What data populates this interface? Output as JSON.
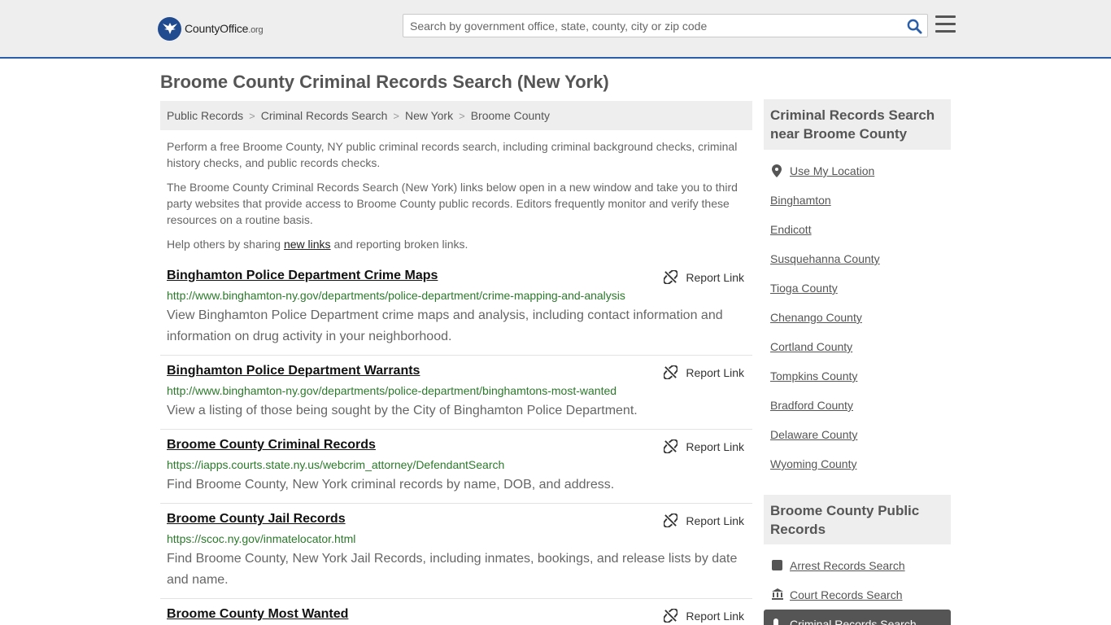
{
  "header": {
    "logo_main": "CountyOffice",
    "logo_tld": ".org",
    "search_placeholder": "Search by government office, state, county, city or zip code"
  },
  "page_title": "Broome County Criminal Records Search (New York)",
  "breadcrumb": [
    "Public Records",
    "Criminal Records Search",
    "New York",
    "Broome County"
  ],
  "intro": {
    "p1": "Perform a free Broome County, NY public criminal records search, including criminal background checks, criminal history checks, and public records checks.",
    "p2": "The Broome County Criminal Records Search (New York) links below open in a new window and take you to third party websites that provide access to Broome County public records. Editors frequently monitor and verify these resources on a routine basis.",
    "p3_before": "Help others by sharing ",
    "p3_link": "new links",
    "p3_after": " and reporting broken links."
  },
  "report_label": "Report Link",
  "links": [
    {
      "name": "Binghamton Police Department Crime Maps",
      "url": "http://www.binghamton-ny.gov/departments/police-department/crime-mapping-and-analysis",
      "desc": "View Binghamton Police Department crime maps and analysis, including contact information and information on drug activity in your neighborhood."
    },
    {
      "name": "Binghamton Police Department Warrants",
      "url": "http://www.binghamton-ny.gov/departments/police-department/binghamtons-most-wanted",
      "desc": "View a listing of those being sought by the City of Binghamton Police Department."
    },
    {
      "name": "Broome County Criminal Records",
      "url": "https://iapps.courts.state.ny.us/webcrim_attorney/DefendantSearch",
      "desc": "Find Broome County, New York criminal records by name, DOB, and address."
    },
    {
      "name": "Broome County Jail Records",
      "url": "https://scoc.ny.gov/inmatelocator.html",
      "desc": "Find Broome County, New York Jail Records, including inmates, bookings, and release lists by date and name."
    },
    {
      "name": "Broome County Most Wanted",
      "url": "",
      "desc": ""
    }
  ],
  "sidebar": {
    "nearby_heading": "Criminal Records Search near Broome County",
    "use_location": "Use My Location",
    "nearby": [
      "Binghamton",
      "Endicott",
      "Susquehanna County",
      "Tioga County",
      "Chenango County",
      "Cortland County",
      "Tompkins County",
      "Bradford County",
      "Delaware County",
      "Wyoming County"
    ],
    "public_heading": "Broome County Public Records",
    "public_links": [
      "Arrest Records Search",
      "Court Records Search",
      "Criminal Records Search"
    ]
  }
}
